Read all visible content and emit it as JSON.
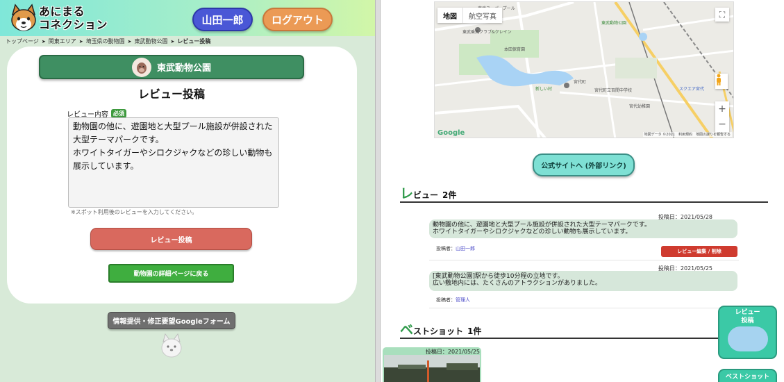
{
  "header": {
    "logo_text_line1": "あにまる",
    "logo_text_line2": "コネクション",
    "user_name": "山田一郎",
    "logout_label": "ログアウト"
  },
  "breadcrumb": {
    "items": [
      "トップページ",
      "関東エリア",
      "埼玉県の動物園",
      "東武動物公園"
    ],
    "current": "レビュー投稿"
  },
  "form": {
    "zoo_name": "東武動物公園",
    "title": "レビュー投稿",
    "content_label": "レビュー内容",
    "required_label": "必須",
    "textarea_value": "動物園の他に、遊園地と大型プール施設が併設された大型テーマパークです。\nホワイトタイガーやシロクジャクなどの珍しい動物も展示しています。",
    "hint": "※スポット利用後のレビューを入力してください。",
    "submit_label": "レビュー投稿",
    "back_label": "動物園の詳細ページに戻る"
  },
  "footer": {
    "google_form_label": "情報提供・修正要望Googleフォーム"
  },
  "map": {
    "map_type_map": "地図",
    "map_type_satellite": "航空写真",
    "google_logo": "Google",
    "attribution": "地図データ ©2021　利用規約　地図の誤りを報告する",
    "zoom_in": "+",
    "zoom_out": "−",
    "labels": {
      "label_1": "東武スーパープール",
      "label_2": "東武乗馬クラブ&クレイン",
      "label_3": "本田保育園",
      "label_4": "東武動物公園",
      "label_5": "宮代町",
      "label_6": "宮代町立百間中学校",
      "label_7": "新しい村",
      "label_8": "宮代幼稚園",
      "label_9": "スクエア宮代"
    }
  },
  "official_site_label": "公式サイトへ (外部リンク)",
  "reviews": {
    "section_first_char": "レ",
    "section_rest": "ビュー",
    "count_label": "2件",
    "items": [
      {
        "date_label": "投稿日：2021/05/28",
        "text": "動物園の他に、遊園地と大型プール施設が併設された大型テーマパークです。\nホワイトタイガーやシロクジャクなどの珍しい動物も展示しています。",
        "author_prefix": "投稿者：",
        "author": "山田一郎",
        "edit_label": "レビュー編集 / 削除"
      },
      {
        "date_label": "投稿日：2021/05/25",
        "text": "[東武動物公園]駅から徒歩10分程の立地です。\n広い敷地内には、たくさんのアトラクションがありました。",
        "author_prefix": "投稿者：",
        "author": "管理人"
      }
    ]
  },
  "bestshots": {
    "section_first_char": "ベ",
    "section_rest": "ストショット",
    "count_label": "1件",
    "items": [
      {
        "date_label": "投稿日：2021/05/25"
      }
    ]
  },
  "floating": {
    "review_line1": "レビュー",
    "review_line2": "投稿",
    "bestshot_label": "ベストショット"
  }
}
